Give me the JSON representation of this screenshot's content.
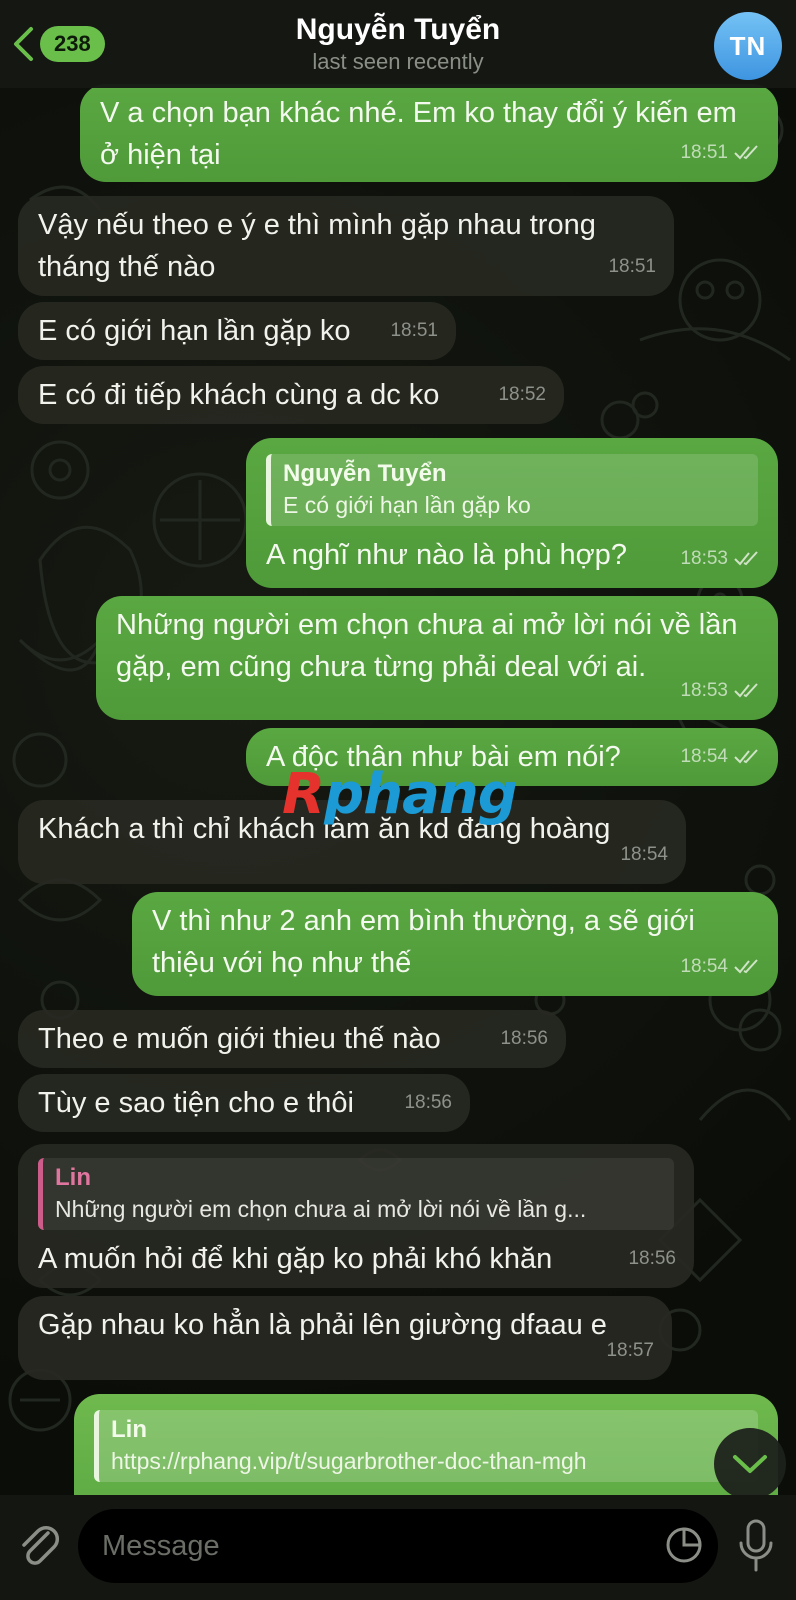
{
  "header": {
    "back_count": "238",
    "contact_name": "Nguyễn Tuyển",
    "status": "last seen recently",
    "avatar_initials": "TN"
  },
  "colors": {
    "outgoing_bubble": "#5aa842",
    "incoming_bubble": "#262821",
    "accent": "#6abf4b",
    "avatar": "#4ea6e8"
  },
  "messages": [
    {
      "dir": "out",
      "text": "V a chọn bạn khác nhé. Em ko thay đổi ý kiến em ở hiện tại",
      "time": "18:51",
      "read": true
    },
    {
      "dir": "in",
      "text": "Vậy nếu theo e ý e thì mình gặp nhau trong tháng thế nào",
      "time": "18:51"
    },
    {
      "dir": "in",
      "text": "E có giới hạn lần gặp ko",
      "time": "18:51"
    },
    {
      "dir": "in",
      "text": "E có đi tiếp khách cùng a dc ko",
      "time": "18:52"
    },
    {
      "dir": "out",
      "reply_name": "Nguyễn Tuyển",
      "reply_text": "E có giới hạn lần gặp ko",
      "text": "A nghĩ như nào là phù hợp?",
      "time": "18:53",
      "read": true
    },
    {
      "dir": "out",
      "text": "Những người em chọn chưa ai mở lời nói về lần gặp, em cũng chưa từng phải deal với ai.",
      "time": "18:53",
      "read": true
    },
    {
      "dir": "out",
      "text": "A độc thân như bài em nói?",
      "time": "18:54",
      "read": true
    },
    {
      "dir": "in",
      "text": "Khách a thì chỉ khách làm ăn kd đang hoàng",
      "time": "18:54"
    },
    {
      "dir": "out",
      "text": "V thì như 2 anh em bình thường, a sẽ giới thiệu với họ như thế",
      "time": "18:54",
      "read": true
    },
    {
      "dir": "in",
      "text": "Theo e muốn giới thieu thế nào",
      "time": "18:56"
    },
    {
      "dir": "in",
      "text": "Tùy e sao tiện cho e thôi",
      "time": "18:56"
    },
    {
      "dir": "in",
      "reply_name": "Lin",
      "reply_text": "Những người em chọn chưa ai mở lời nói về lần g...",
      "text": "A muốn hỏi để khi gặp ko phải khó khăn",
      "time": "18:56"
    },
    {
      "dir": "in",
      "text": "Gặp nhau ko hẳn là phải lên giường dfaau e",
      "time": "18:57"
    },
    {
      "dir": "out",
      "reply_name": "Lin",
      "reply_text": "https://rphang.vip/t/sugarbrother-doc-than-mgh"
    }
  ],
  "watermark": {
    "r": "R",
    "rest": "phang"
  },
  "composer": {
    "placeholder": "Message"
  }
}
